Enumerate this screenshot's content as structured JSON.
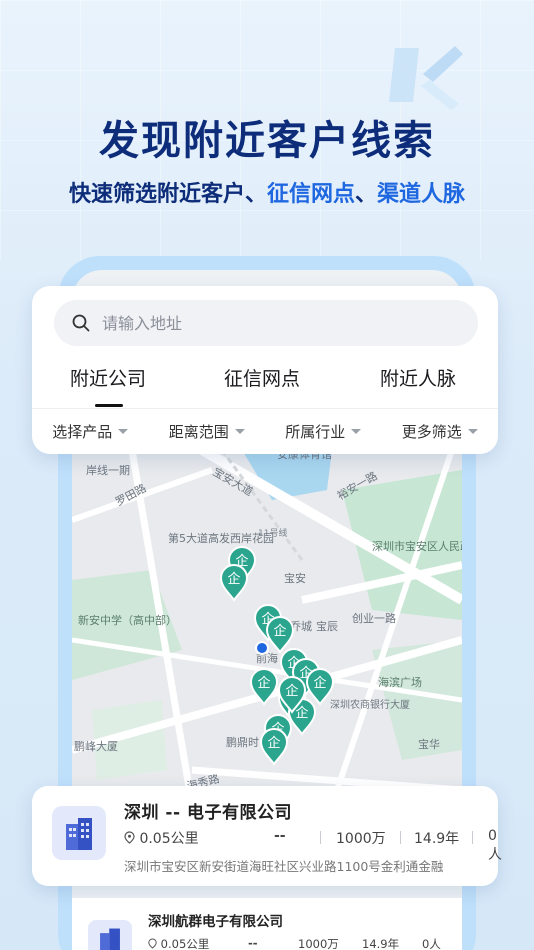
{
  "headline": "发现附近客户线索",
  "subline": {
    "part1": "快速筛选附近客户、",
    "part2": "征信网点",
    "part3": "、",
    "part4": "渠道人脉"
  },
  "search": {
    "placeholder": "请输入地址"
  },
  "tabs": [
    {
      "label": "附近公司",
      "active": true
    },
    {
      "label": "征信网点",
      "active": false
    },
    {
      "label": "附近人脉",
      "active": false
    }
  ],
  "filters": [
    "选择产品",
    "距离范围",
    "所属行业",
    "更多筛选"
  ],
  "map": {
    "labels": {
      "anxin": "安康体育馆",
      "shore": "岸线一期",
      "luoan": "罗田路",
      "bao_an_ave": "宝安大道",
      "yuan": "裕安一路",
      "line11": "11号线",
      "park": "第5大道高发西岸花园",
      "gov": "深圳市宝安区人民政府",
      "baoan": "宝安",
      "school": "新安中学（高中部）",
      "qiaocheng": "乔城",
      "baochen": "宝辰",
      "chuangye": "创业一路",
      "qianhai": "前海",
      "square": "海滨广场",
      "bank": "深圳农商银行大厦",
      "pengfeng": "鹏峰大厦",
      "pengding": "鹏鼎时",
      "haixiu": "海秀路",
      "baohua": "宝华",
      "pin_glyph": "企"
    }
  },
  "result": {
    "name": "深圳 -- 电子有限公司",
    "distance": "0.05公里",
    "legal": "--",
    "capital": "1000万",
    "years": "14.9年",
    "people": "0人",
    "address": "深圳市宝安区新安街道海旺社区兴业路1100号金利通金融"
  },
  "result2": {
    "name": "深圳航群电子有限公司",
    "distance": "0.05公里",
    "legal": "--",
    "capital": "1000万",
    "years": "14.9年",
    "people": "0人"
  },
  "colors": {
    "headline": "#0d2c7a",
    "accent": "#1f67e0",
    "pin": "#2ba58e"
  }
}
